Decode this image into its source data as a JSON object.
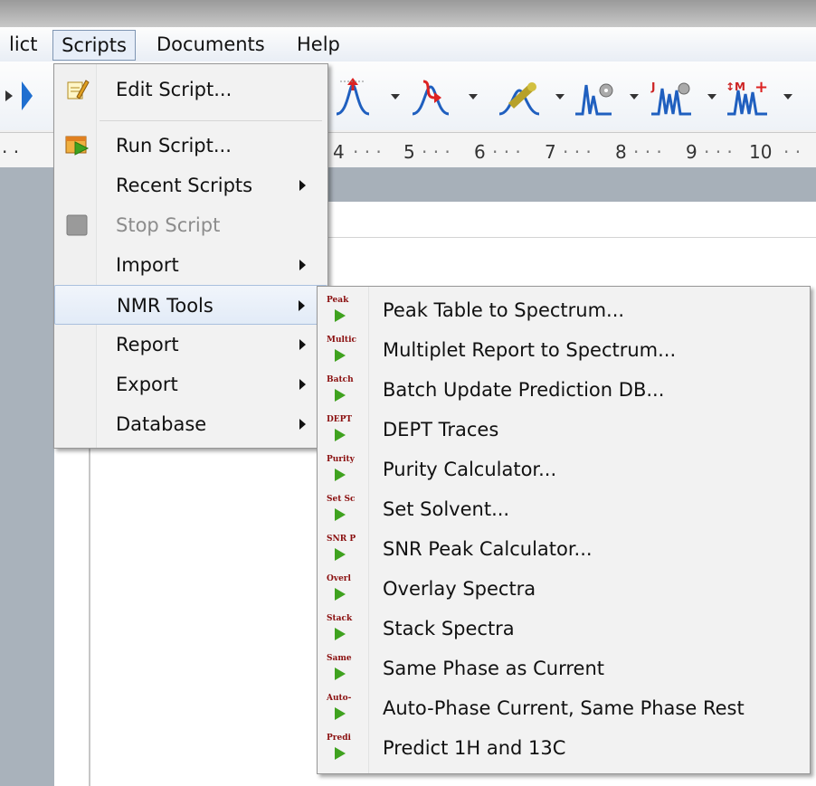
{
  "menubar": {
    "items": [
      {
        "label": "lict"
      },
      {
        "label": "Scripts"
      },
      {
        "label": "Documents"
      },
      {
        "label": "Help"
      }
    ]
  },
  "ruler": {
    "ticks": [
      "4",
      "5",
      "6",
      "7",
      "8",
      "9",
      "10"
    ]
  },
  "scripts_menu": {
    "items": [
      {
        "label": "Edit Script...",
        "icon": "edit-script-icon"
      },
      {
        "label": "Run Script...",
        "icon": "run-script-icon"
      },
      {
        "label": "Recent Scripts",
        "submenu": true
      },
      {
        "label": "Stop Script",
        "disabled": true,
        "icon": "stop-script-icon"
      },
      {
        "label": "Import",
        "submenu": true
      },
      {
        "label": "NMR Tools",
        "submenu": true,
        "highlighted": true
      },
      {
        "label": "Report",
        "submenu": true
      },
      {
        "label": "Export",
        "submenu": true
      },
      {
        "label": "Database",
        "submenu": true
      }
    ]
  },
  "nmr_tools_menu": {
    "items": [
      {
        "label": "Peak Table to Spectrum...",
        "tag": "Peak"
      },
      {
        "label": "Multiplet Report to Spectrum...",
        "tag": "Multic"
      },
      {
        "label": "Batch Update Prediction DB...",
        "tag": "Batch"
      },
      {
        "label": "DEPT Traces",
        "tag": "DEPT"
      },
      {
        "label": "Purity Calculator...",
        "tag": "Purity"
      },
      {
        "label": "Set Solvent...",
        "tag": "Set Sc"
      },
      {
        "label": "SNR Peak Calculator...",
        "tag": "SNR P"
      },
      {
        "label": "Overlay Spectra",
        "tag": "Overl"
      },
      {
        "label": "Stack Spectra",
        "tag": "Stack"
      },
      {
        "label": "Same Phase as Current",
        "tag": "Same"
      },
      {
        "label": "Auto-Phase Current, Same Phase Rest",
        "tag": "Auto-"
      },
      {
        "label": "Predict 1H and 13C",
        "tag": "Predi"
      }
    ]
  },
  "colors": {
    "accent_red": "#c0392b",
    "play_green": "#3fa21f",
    "highlight": "#e2ebf7"
  }
}
